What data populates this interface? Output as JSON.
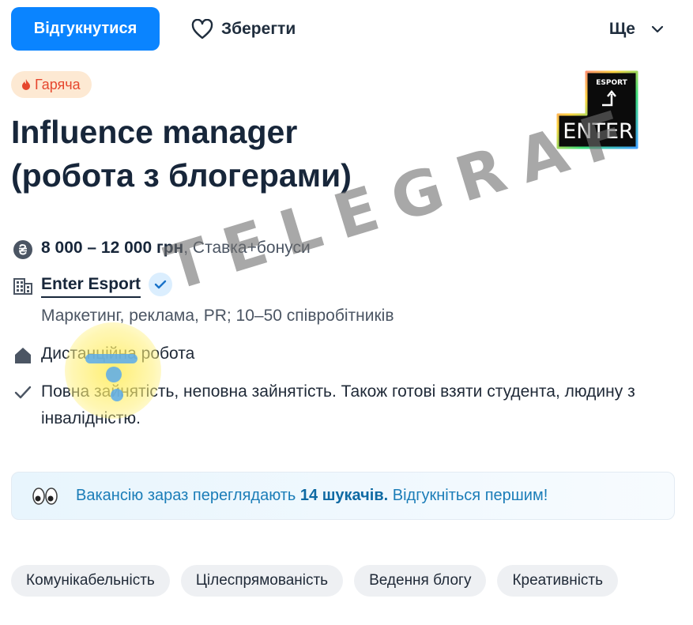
{
  "actions": {
    "apply_label": "Відгукнутися",
    "save_label": "Зберегти",
    "more_label": "Ще"
  },
  "badge": {
    "label": "Гаряча"
  },
  "job": {
    "title_line1": "Influence manager",
    "title_line2": "(робота з блогерами)"
  },
  "company_logo": {
    "top_text": "ESPORT",
    "main_text": "ENTER"
  },
  "details": {
    "salary_amount": "8 000 – 12 000 грн",
    "salary_note": ", Ставка+бонуси",
    "company_name": "Enter Esport",
    "company_info": "Маркетинг, реклама, PR; 10–50 співробітників",
    "work_format": "Дистанційна робота",
    "employment_line1": "Повна зайнятість, неповна зайнятість. Також готові взяти студента, людину з",
    "employment_line2": "інвалідністю."
  },
  "viewers": {
    "text_before": "Вакансію зараз переглядають",
    "count_text": "14 шукачів.",
    "text_after": "Відгукніться першим!"
  },
  "skills": [
    "Комунікабельність",
    "Цілеспрямованість",
    "Ведення блогу",
    "Креативність"
  ],
  "watermark": {
    "text": "TELEGRAF"
  },
  "colors": {
    "primary": "#0a84ff",
    "title": "#17263a",
    "hot_bg": "#fde9d3",
    "hot_text": "#e6472e",
    "viewers_text": "#1b7db8",
    "tag_bg": "#eef0f3"
  }
}
